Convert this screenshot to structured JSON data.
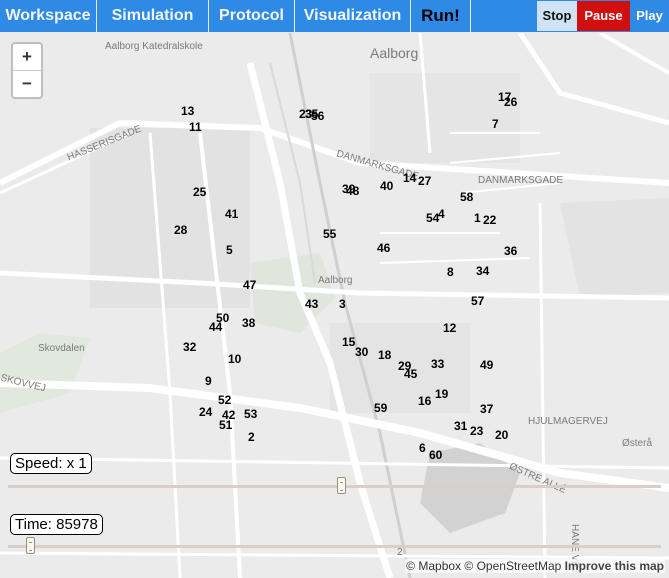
{
  "menu": {
    "tabs": [
      "Workspace",
      "Simulation",
      "Protocol",
      "Visualization",
      "Run!"
    ],
    "stop": "Stop",
    "pause": "Pause",
    "play": "Play"
  },
  "map": {
    "zoom_in": "+",
    "zoom_out": "−",
    "speed_label": "Speed: x 1",
    "speed_value": 1,
    "time_label": "Time: 85978",
    "attribution_mapbox": "© Mapbox",
    "attribution_osm": "© OpenStreetMap",
    "attribution_improve": "Improve this map",
    "place_labels": [
      "Aalborg Katedralskole",
      "Aalborg",
      "HASSERISGADE",
      "DANMARKSGADE",
      "DANMARKSGADE",
      "Aalborg",
      "Skovdalen",
      "SKOVVEJ",
      "HJULMAGERVEJ",
      "Østerå",
      "ØSTRE ALLÉ",
      "HANE VEJ",
      "2"
    ],
    "nodes": [
      "13",
      "11",
      "23",
      "35",
      "56",
      "17",
      "26",
      "7",
      "14",
      "27",
      "39",
      "48",
      "40",
      "58",
      "54",
      "4",
      "1",
      "22",
      "25",
      "41",
      "28",
      "5",
      "55",
      "46",
      "36",
      "8",
      "34",
      "47",
      "43",
      "3",
      "57",
      "50",
      "44",
      "38",
      "12",
      "32",
      "15",
      "30",
      "18",
      "29",
      "45",
      "33",
      "49",
      "10",
      "9",
      "19",
      "52",
      "24",
      "42",
      "53",
      "16",
      "59",
      "37",
      "51",
      "31",
      "23",
      "20",
      "2",
      "6",
      "60"
    ]
  },
  "colors": {
    "topbar": "#2f8ae6",
    "stop_bg": "#cfe3f7",
    "pause_bg": "#d10f0f",
    "play_bg": "#2f8ae6"
  }
}
